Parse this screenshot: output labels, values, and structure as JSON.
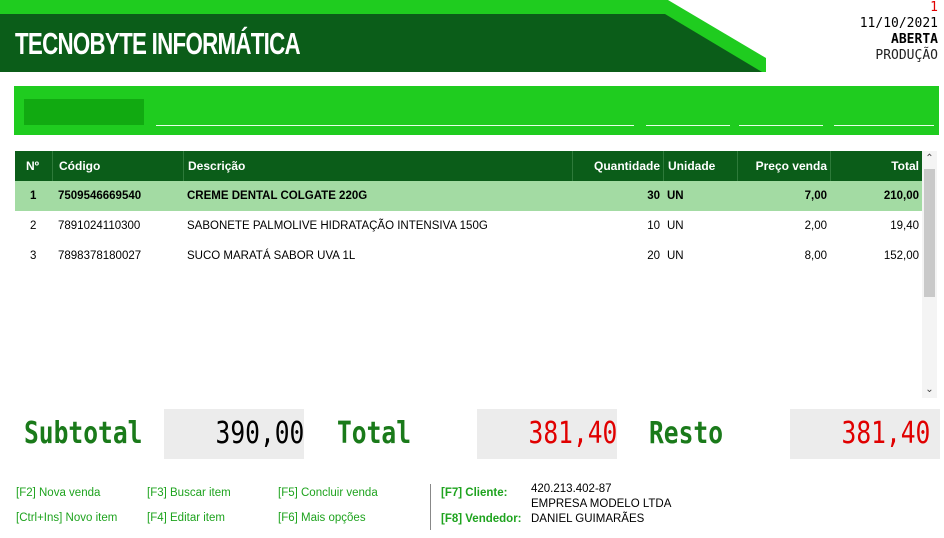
{
  "header": {
    "brand": "TECNOBYTE INFORMÁTICA",
    "sale_number": "1",
    "date": "11/10/2021",
    "status": "ABERTA",
    "environment": "PRODUÇÃO",
    "colors": {
      "dark_green": "#0b5d19",
      "light_green": "#1fcc1f"
    }
  },
  "grid": {
    "columns": [
      "Nº",
      "Código",
      "Descrição",
      "Quantidade",
      "Unidade",
      "Preço venda",
      "Total"
    ],
    "rows": [
      [
        "1",
        "7509546669540",
        "CREME DENTAL COLGATE 220G",
        "30",
        "UN",
        "7,00",
        "210,00"
      ],
      [
        "2",
        "7891024110300",
        "SABONETE PALMOLIVE HIDRATAÇÃO INTENSIVA 150G",
        "10",
        "UN",
        "2,00",
        "19,40"
      ],
      [
        "3",
        "7898378180027",
        "SUCO MARATÁ SABOR UVA 1L",
        "20",
        "UN",
        "8,00",
        "152,00"
      ]
    ],
    "selected_row": 0
  },
  "totals": {
    "subtotal_label": "Subtotal",
    "subtotal_value": "390,00",
    "total_label": "Total",
    "total_value": "381,40",
    "rest_label": "Resto",
    "rest_value": "381,40"
  },
  "shortcuts": {
    "new_sale": "[F2] Nova venda",
    "new_item": "[Ctrl+Ins] Novo item",
    "search_item": "[F3] Buscar item",
    "edit_item": "[F4] Editar item",
    "finish_sale": "[F5] Concluir venda",
    "more_options": "[F6] Mais opções"
  },
  "customer": {
    "client_label": "[F7] Cliente:",
    "client_doc": "420.213.402-87",
    "client_name": "EMPRESA MODELO LTDA",
    "seller_label": "[F8] Vendedor:",
    "seller_name": "DANIEL GUIMARÃES"
  }
}
